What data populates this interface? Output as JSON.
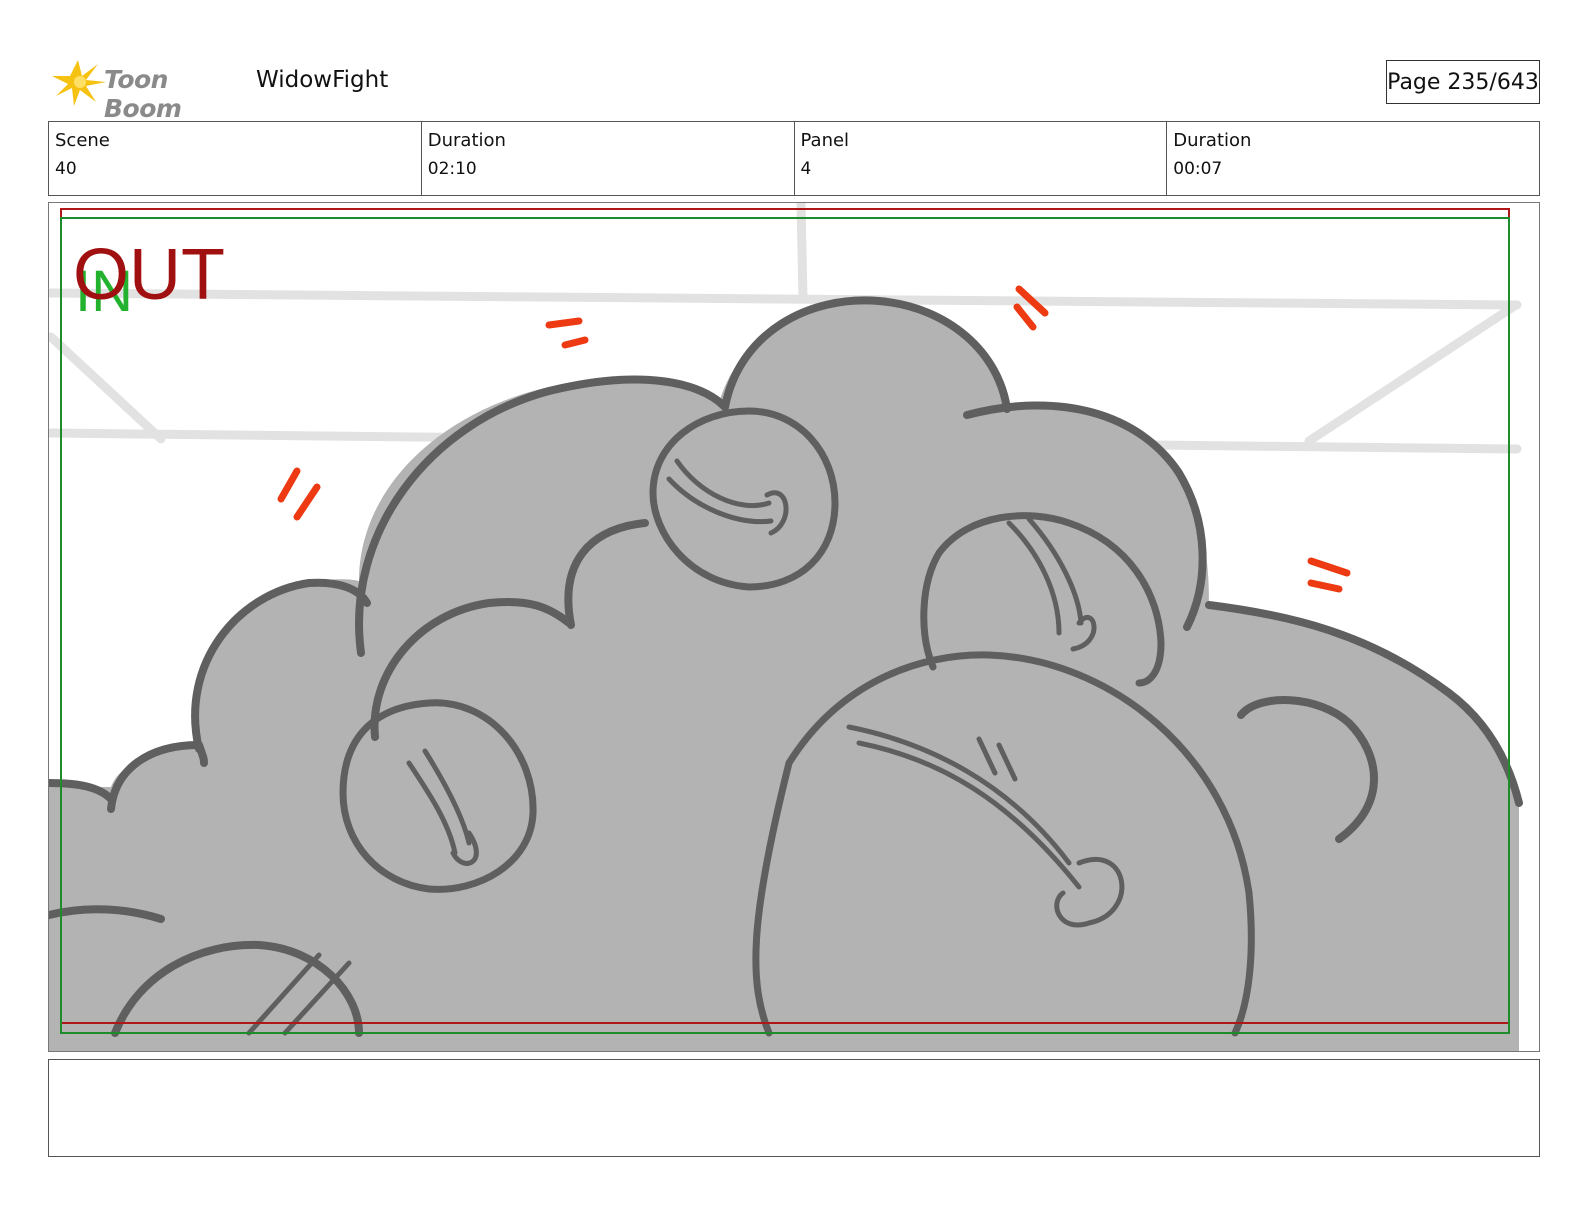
{
  "header": {
    "logo_text": "Toon Boom",
    "project_title": "WidowFight",
    "page_label": "Page 235/643"
  },
  "info": [
    {
      "label": "Scene",
      "value": "40"
    },
    {
      "label": "Duration",
      "value": "02:10"
    },
    {
      "label": "Panel",
      "value": "4"
    },
    {
      "label": "Duration",
      "value": "00:07"
    }
  ],
  "panel": {
    "in_marker": "IN",
    "out_marker": "OUT",
    "colors": {
      "out_frame": "#b01818",
      "in_frame": "#1e8c2a",
      "in_text": "#22b22e",
      "out_text": "#a01010",
      "smoke_fill": "#b3b3b3",
      "smoke_line": "#5f5f5f",
      "action_lines": "#ee3a12",
      "background_lines": "#e2e2e2"
    }
  },
  "notes": {
    "text": ""
  }
}
